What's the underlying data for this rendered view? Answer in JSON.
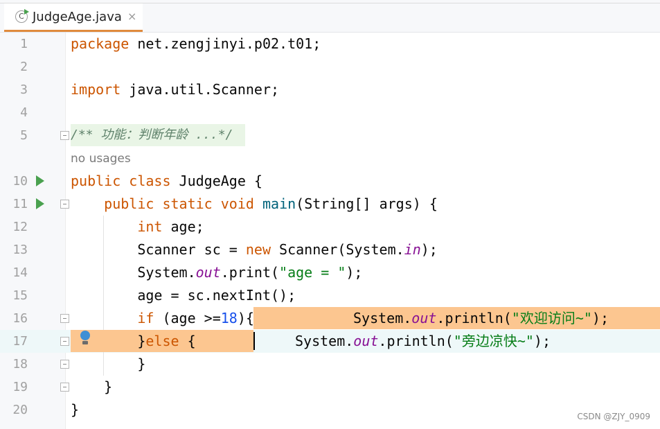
{
  "tab": {
    "title": "JudgeAge.java",
    "close": "×",
    "icon_letter": "C",
    "icon": "java-class-icon"
  },
  "lines": [
    {
      "num": "1",
      "text": "package net.zengjinyi.p02.t01;"
    },
    {
      "num": "2",
      "text": ""
    },
    {
      "num": "3",
      "text": "import java.util.Scanner;"
    },
    {
      "num": "4",
      "text": ""
    },
    {
      "num": "5",
      "text": "/** 功能：判断年龄 ...*/"
    },
    {
      "num": "10",
      "text": "public class JudgeAge {"
    },
    {
      "num": "11",
      "text": "    public static void main(String[] args) {"
    },
    {
      "num": "12",
      "text": "        int age;"
    },
    {
      "num": "13",
      "text": "        Scanner sc = new Scanner(System.in);"
    },
    {
      "num": "14",
      "text": "        System.out.print(\"age = \");"
    },
    {
      "num": "15",
      "text": "        age = sc.nextInt();"
    },
    {
      "num": "16",
      "text": "        if (age >=18){"
    },
    {
      "num": "17",
      "text": "        }else {"
    },
    {
      "num": "18",
      "text": "        }"
    },
    {
      "num": "19",
      "text": "    }"
    },
    {
      "num": "20",
      "text": "}"
    }
  ],
  "hint": "no usages",
  "println1": "System.out.println(\"欢迎访问~\");",
  "println2": "System.out.println(\"旁边凉快~\");",
  "watermark": "CSDN @ZJY_0909",
  "colors": {
    "keyword": "#cc5500",
    "string": "#067d17",
    "number": "#1750eb",
    "static_field": "#871094",
    "highlight": "#fcc690",
    "run": "#4aa14f"
  }
}
